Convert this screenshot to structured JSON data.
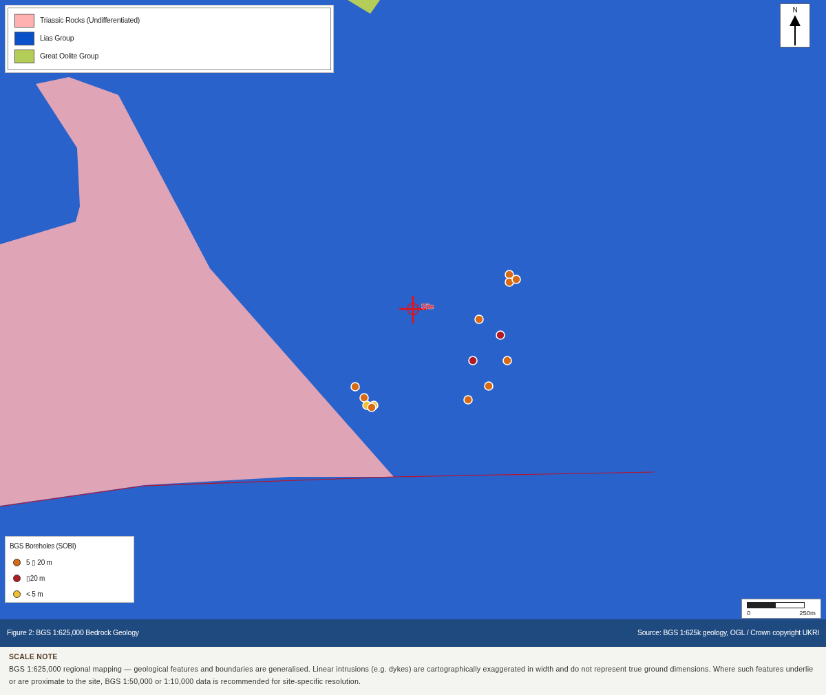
{
  "geology_legend": [
    {
      "label": "Triassic Rocks (Undifferentiated)",
      "color": "#ffb0b0"
    },
    {
      "label": "Lias Group",
      "color": "#0a50c8"
    },
    {
      "label": "Great Oolite Group",
      "color": "#b4cc58"
    }
  ],
  "map": {
    "site_label": "Site",
    "north_label": "N",
    "scale_start": "0",
    "scale_end": "250m"
  },
  "boreholes_legend": {
    "title": "BGS Boreholes (SOBI)",
    "items": [
      {
        "label": "5 ▯ 20 m",
        "color": "#d86a14"
      },
      {
        "label": "▯20 m",
        "color": "#b01c24"
      },
      {
        "label": "< 5 m",
        "color": "#f0c030"
      }
    ]
  },
  "boreholes": [
    {
      "color": "#d86a14"
    },
    {
      "color": "#d86a14"
    },
    {
      "color": "#d86a14"
    },
    {
      "color": "#d86a14"
    },
    {
      "color": "#b01c24"
    },
    {
      "color": "#b01c24"
    },
    {
      "color": "#d86a14"
    },
    {
      "color": "#d86a14"
    },
    {
      "color": "#d86a14"
    },
    {
      "color": "#d86a14"
    },
    {
      "color": "#d86a14"
    },
    {
      "color": "#f0c030"
    },
    {
      "color": "#f0c030"
    },
    {
      "color": "#d86a14"
    }
  ],
  "caption_bar": {
    "title": "Figure 2: BGS 1:625,000 Bedrock Geology",
    "source": "Source: BGS 1:625k geology, OGL / Crown copyright UKRI"
  },
  "scale_note": {
    "title": "SCALE NOTE",
    "text": "BGS 1:625,000 regional mapping — geological features and boundaries are generalised. Linear intrusions (e.g. dykes) are cartographically exaggerated in width and do not represent true ground dimensions. Where such features underlie or are proximate to the site, BGS 1:50,000 or 1:10,000 data is recommended for site-specific resolution."
  }
}
